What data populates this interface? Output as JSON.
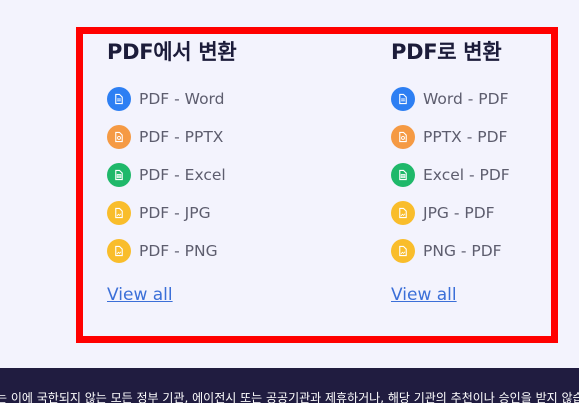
{
  "colors": {
    "highlight": "#ff0000",
    "background": "#f3f3fd",
    "footer": "#201c40",
    "link": "#3b6fd8"
  },
  "from_pdf": {
    "title": "PDF에서 변환",
    "items": [
      {
        "label": "PDF - Word",
        "icon": "word-file-icon",
        "color": "#2d7ff3"
      },
      {
        "label": "PDF - PPTX",
        "icon": "pptx-file-icon",
        "color": "#f59a44"
      },
      {
        "label": "PDF - Excel",
        "icon": "excel-file-icon",
        "color": "#1fb86a"
      },
      {
        "label": "PDF - JPG",
        "icon": "image-file-icon",
        "color": "#f9bd2b"
      },
      {
        "label": "PDF - PNG",
        "icon": "image-file-icon",
        "color": "#f9bd2b"
      }
    ],
    "view_all": "View all"
  },
  "to_pdf": {
    "title": "PDF로 변환",
    "items": [
      {
        "label": "Word - PDF",
        "icon": "word-file-icon",
        "color": "#2d7ff3"
      },
      {
        "label": "PPTX - PDF",
        "icon": "pptx-file-icon",
        "color": "#f59a44"
      },
      {
        "label": "Excel - PDF",
        "icon": "excel-file-icon",
        "color": "#1fb86a"
      },
      {
        "label": "JPG - PDF",
        "icon": "image-file-icon",
        "color": "#f9bd2b"
      },
      {
        "label": "PNG - PDF",
        "icon": "image-file-icon",
        "color": "#f9bd2b"
      }
    ],
    "view_all": "View all"
  },
  "footer": {
    "text": "는 이에 국한되지 않는 모든 정부 기관, 에이전시 또는 공공기관과 제휴하거나, 해당 기관의 추천이나 승인을 받지 않습니다"
  }
}
